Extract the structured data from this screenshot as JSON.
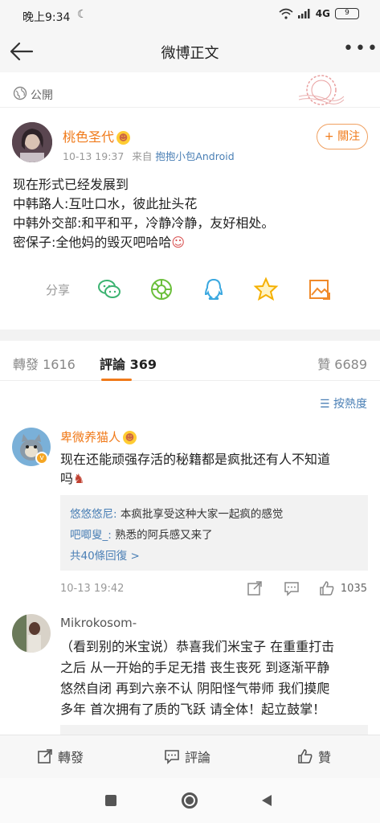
{
  "status_bar": {
    "time": "晚上9:34",
    "network": "4G",
    "battery": "9"
  },
  "nav": {
    "title": "微博正文"
  },
  "visibility": {
    "label": "公開"
  },
  "post": {
    "username": "桃色圣代",
    "time": "10-13 19:37",
    "source_prefix": "来自",
    "source": "抱抱小包Android",
    "follow_label": "+ 關注",
    "lines": [
      "现在形式已经发展到",
      "中韩路人:互吐口水，彼此扯头花",
      "中韩外交部:和平和平，冷静冷静，友好相处。",
      "密保子:全他妈的毁灭吧哈哈"
    ],
    "share_label": "分享"
  },
  "tabs": {
    "repost": "轉發 1616",
    "comment": "評論 369",
    "like": "贊 6689"
  },
  "sort_label": "按熱度",
  "comments": [
    {
      "username": "卑微养猫人",
      "text_line1": "现在还能顽强存活的秘籍都是疯批还有人不知道",
      "text_line2": "吗",
      "replies": [
        {
          "name": "悠悠悠尼:",
          "text": "本疯批享受这种大家一起疯的感觉"
        },
        {
          "name": "吧唧叟_:",
          "text": "熟悉的阿兵感又来了"
        }
      ],
      "more_replies": "共40條回復 >",
      "time": "10-13 19:42",
      "likes": "1035"
    },
    {
      "username": "Mikrokosom-",
      "lines": [
        "（看到别的米宝说）恭喜我们米宝子 在重重打击",
        "之后 从一开始的手足无措 丧生丧死 到逐渐平静",
        "悠然自闭 再到六亲不认 阴阳怪气带师 我们摸爬",
        "多年 首次拥有了质的飞跃 请全体！起立鼓掌！"
      ]
    }
  ],
  "bottom_bar": {
    "repost": "轉發",
    "comment": "評論",
    "like": "贊"
  },
  "colors": {
    "accent": "#f07a1a",
    "link": "#4a7fb5"
  }
}
